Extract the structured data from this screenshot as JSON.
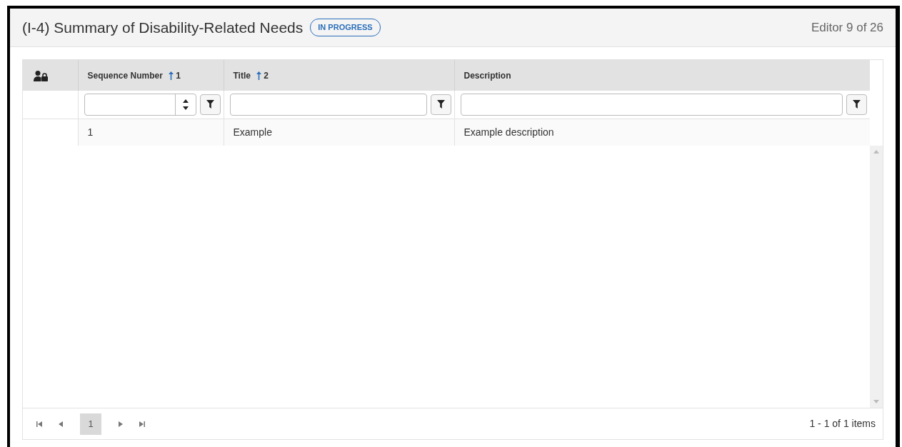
{
  "header": {
    "title": "(I-4) Summary of Disability-Related Needs",
    "status_badge": "IN PROGRESS",
    "editor_position": "Editor 9 of 26"
  },
  "grid": {
    "columns": [
      {
        "kind": "icon"
      },
      {
        "kind": "number",
        "label": "Sequence Number",
        "sort_order": "1"
      },
      {
        "kind": "text",
        "label": "Title",
        "sort_order": "2"
      },
      {
        "kind": "text",
        "label": "Description"
      }
    ],
    "rows": [
      [
        "",
        "1",
        "Example",
        "Example description"
      ]
    ]
  },
  "pager": {
    "pages": [
      {
        "label": "1",
        "selected": true
      }
    ],
    "summary": "1 - 1 of 1 items"
  }
}
